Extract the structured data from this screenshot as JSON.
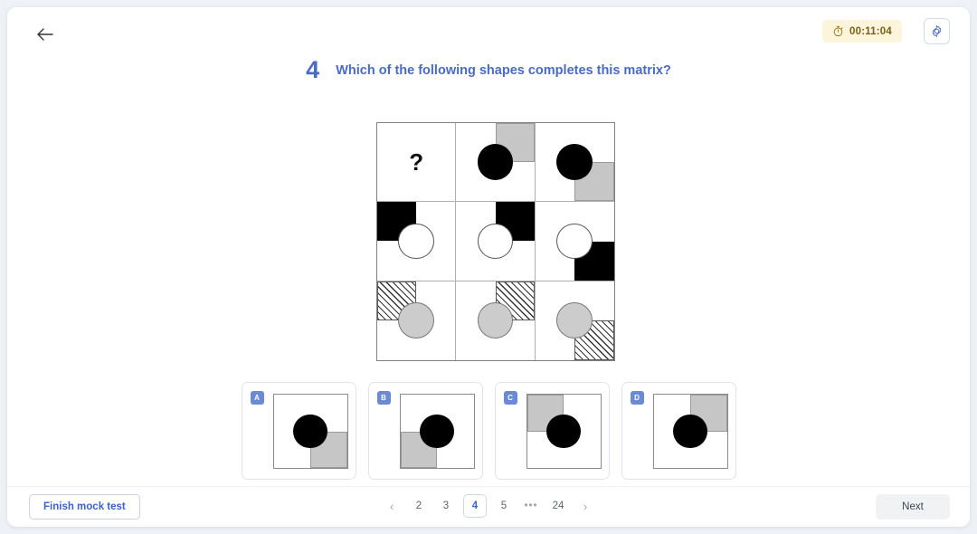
{
  "header": {
    "back_icon": "arrow-left-icon",
    "timer": {
      "icon": "stopwatch-icon",
      "value": "00:11:04",
      "bg": "#fdf4dc",
      "fg": "#7a5f16"
    },
    "settings_icon": "gear-icon"
  },
  "question": {
    "number": "4",
    "text": "Which of the following shapes completes this matrix?",
    "accent": "#4a6bc4"
  },
  "matrix": {
    "rows": 3,
    "cols": 3,
    "cells": [
      {
        "id": "r1c1",
        "quad": null,
        "quad_fill": null,
        "circle": null,
        "circle_pos": null,
        "placeholder": "?"
      },
      {
        "id": "r1c2",
        "quad": "tr",
        "quad_fill": "gray",
        "circle": "black",
        "circle_pos": "tr-corner",
        "placeholder": null
      },
      {
        "id": "r1c3",
        "quad": "br",
        "quad_fill": "gray",
        "circle": "black",
        "circle_pos": "br-corner",
        "placeholder": null
      },
      {
        "id": "r2c1",
        "quad": "tl",
        "quad_fill": "black",
        "circle": "white",
        "circle_pos": "tl-corner",
        "placeholder": null
      },
      {
        "id": "r2c2",
        "quad": "tr",
        "quad_fill": "black",
        "circle": "white",
        "circle_pos": "tr-corner",
        "placeholder": null
      },
      {
        "id": "r2c3",
        "quad": "br",
        "quad_fill": "black",
        "circle": "white",
        "circle_pos": "br-corner",
        "placeholder": null
      },
      {
        "id": "r3c1",
        "quad": "tl",
        "quad_fill": "hatch",
        "circle": "gray",
        "circle_pos": "tl-corner",
        "placeholder": null
      },
      {
        "id": "r3c2",
        "quad": "tr",
        "quad_fill": "hatch",
        "circle": "gray",
        "circle_pos": "tr-corner",
        "placeholder": null
      },
      {
        "id": "r3c3",
        "quad": "br",
        "quad_fill": "hatch",
        "circle": "gray",
        "circle_pos": "br-corner",
        "placeholder": null
      }
    ]
  },
  "options": [
    {
      "letter": "A",
      "quad": "br",
      "quad_fill": "gray",
      "circle": "black",
      "circle_pos": "br-corner"
    },
    {
      "letter": "B",
      "quad": "bl",
      "quad_fill": "gray",
      "circle": "black",
      "circle_pos": "bl-corner"
    },
    {
      "letter": "C",
      "quad": "tl",
      "quad_fill": "gray",
      "circle": "black",
      "circle_pos": "tl-corner"
    },
    {
      "letter": "D",
      "quad": "tr",
      "quad_fill": "gray",
      "circle": "black",
      "circle_pos": "tr-corner"
    }
  ],
  "footer": {
    "finish_label": "Finish mock test",
    "next_label": "Next",
    "pagination": {
      "prev_icon": "chevron-left-icon",
      "next_icon": "chevron-right-icon",
      "pages": [
        "2",
        "3",
        "4",
        "5",
        "…",
        "24"
      ],
      "active": "4"
    }
  },
  "colors": {
    "page_bg": "#eef1f5",
    "card_bg": "#ffffff",
    "accent_blue": "#4a6bc4",
    "badge_blue": "#6a8ad6",
    "gray_fill": "#c6c6c6"
  }
}
